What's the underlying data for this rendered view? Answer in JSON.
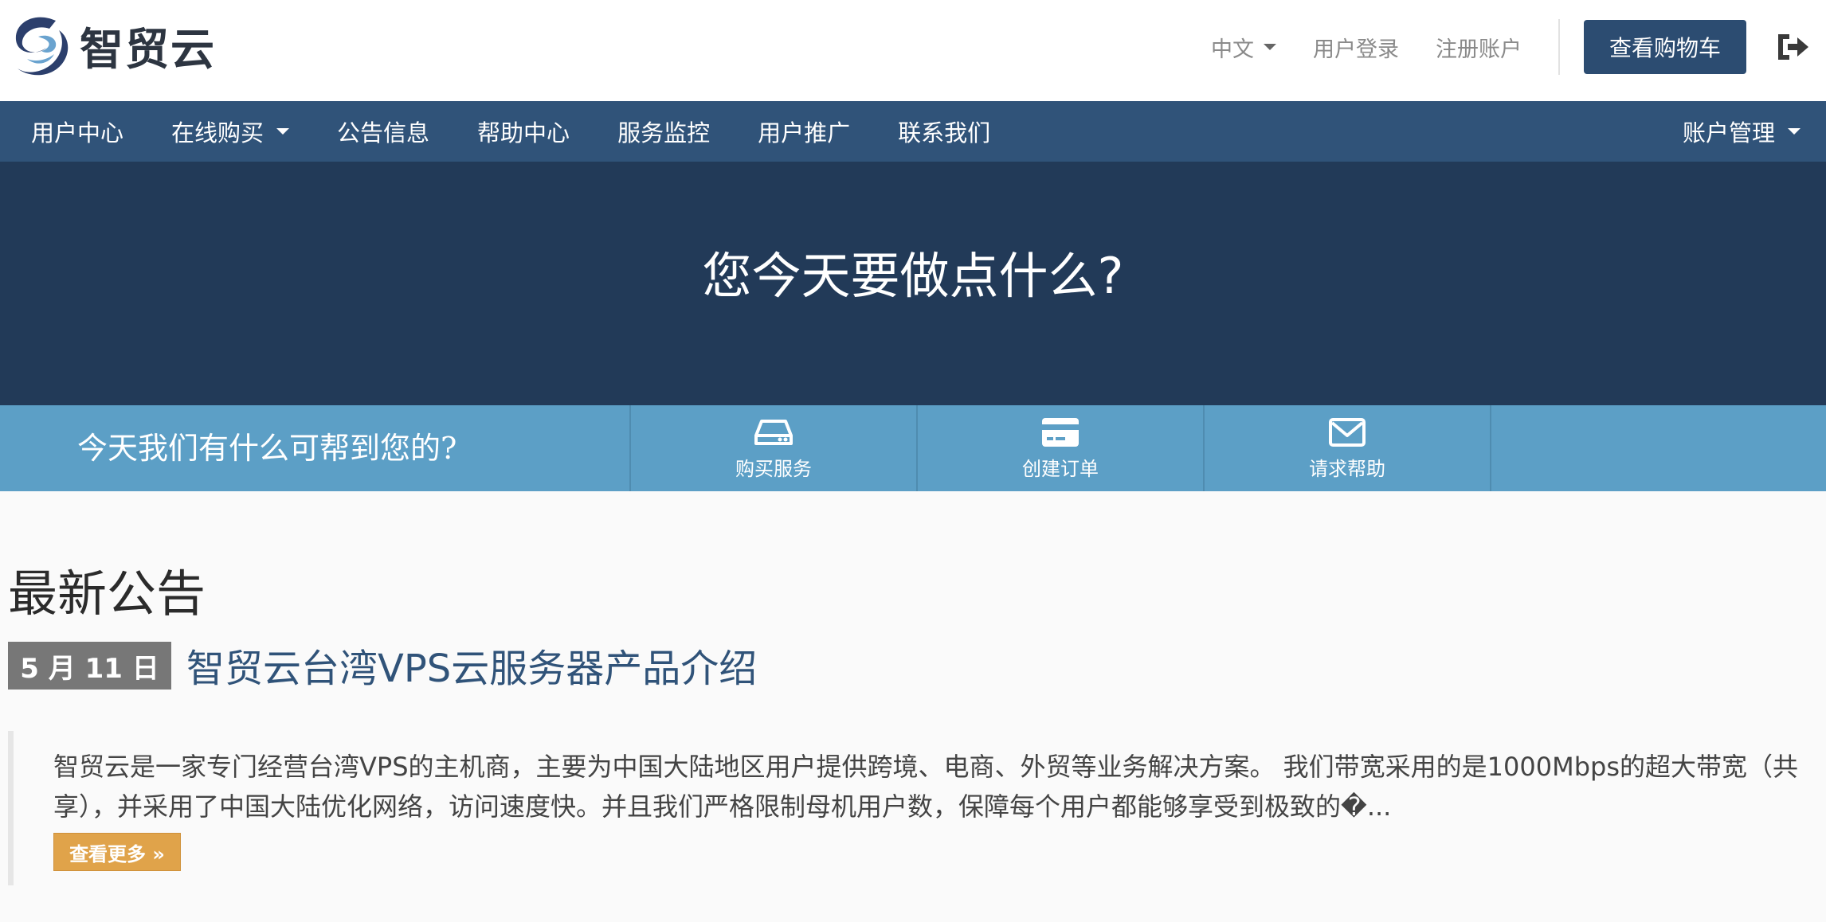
{
  "brand": {
    "logo_text": "智贸云",
    "logo_icon": "swirl-logo-icon",
    "colors": {
      "nav": "#305379",
      "hero": "#223a58",
      "helpbar": "#5c9fc6",
      "accent": "#e0a34a"
    }
  },
  "header": {
    "language_label": "中文",
    "login_label": "用户登录",
    "register_label": "注册账户",
    "cart_label": "查看购物车",
    "logout_icon": "logout-icon"
  },
  "nav": {
    "items": [
      {
        "label": "用户中心"
      },
      {
        "label": "在线购买"
      },
      {
        "label": "公告信息"
      },
      {
        "label": "帮助中心"
      },
      {
        "label": "服务监控"
      },
      {
        "label": "用户推广"
      },
      {
        "label": "联系我们"
      }
    ],
    "account_label": "账户管理"
  },
  "hero": {
    "title": "您今天要做点什么?"
  },
  "helpbar": {
    "text": "今天我们有什么可帮到您的?",
    "actions": [
      {
        "label": "购买服务",
        "icon": "server-icon"
      },
      {
        "label": "创建订单",
        "icon": "credit-card-icon"
      },
      {
        "label": "请求帮助",
        "icon": "envelope-icon"
      }
    ]
  },
  "announcements": {
    "title": "最新公告",
    "items": [
      {
        "date": "5 月 11 日",
        "title": "智贸云台湾VPS云服务器产品介绍",
        "body": "智贸云是一家专门经营台湾VPS的主机商，主要为中国大陆地区用户提供跨境、电商、外贸等业务解决方案。 我们带宽采用的是1000Mbps的超大带宽（共享），并采用了中国大陆优化网络，访问速度快。并且我们严格限制母机用户数，保障每个用户都能够享受到极致的�...",
        "more_label": "查看更多 »"
      }
    ]
  }
}
